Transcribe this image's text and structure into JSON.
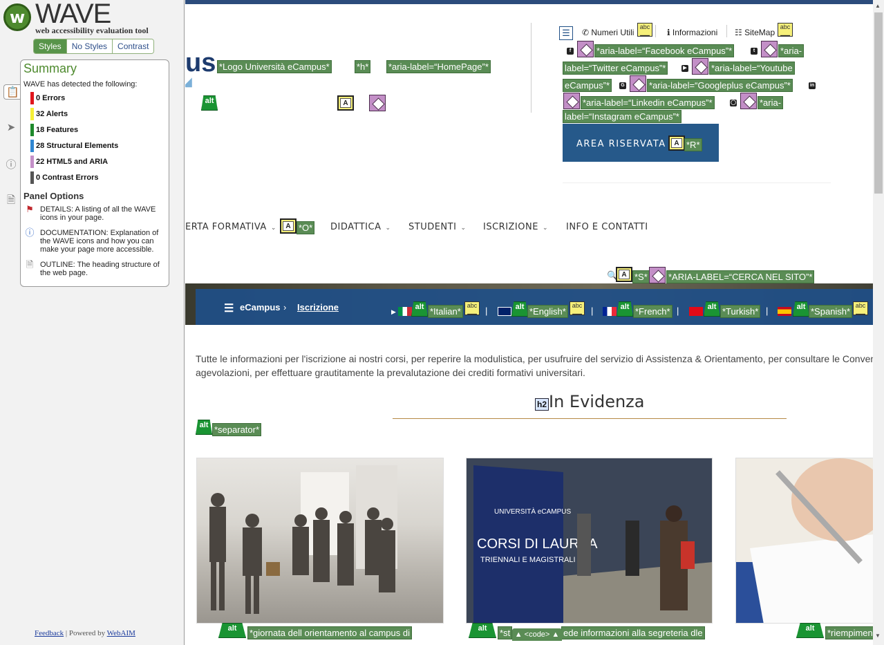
{
  "wave": {
    "title": "WAVE",
    "subtitle": "web accessibility evaluation tool",
    "tabs": [
      {
        "label": "Styles",
        "active": true
      },
      {
        "label": "No Styles",
        "active": false
      },
      {
        "label": "Contrast",
        "active": false
      }
    ],
    "sidebar_icons": [
      "clipboard-icon",
      "flag-icon",
      "info-icon",
      "document-icon"
    ],
    "summary": {
      "title": "Summary",
      "intro": "WAVE has detected the following:",
      "counts": [
        {
          "label": "0 Errors",
          "color": "#e0161c"
        },
        {
          "label": "32 Alerts",
          "color": "#f5ef37"
        },
        {
          "label": "18 Features",
          "color": "#1f8a2c"
        },
        {
          "label": "28 Structural Elements",
          "color": "#2f86d1"
        },
        {
          "label": "22 HTML5 and ARIA",
          "color": "#c490c8"
        },
        {
          "label": "0 Contrast Errors",
          "color": "#555555"
        }
      ]
    },
    "panel_options": {
      "title": "Panel Options",
      "items": [
        {
          "icon": "red-flag-icon",
          "text": "DETAILS: A listing of all the WAVE icons in your page."
        },
        {
          "icon": "info-icon",
          "text": "DOCUMENTATION: Explanation of the WAVE icons and how you can make your page more accessible."
        },
        {
          "icon": "outline-icon",
          "text": "OUTLINE: The heading structure of the web page."
        }
      ]
    },
    "footer": {
      "feedback": "Feedback",
      "sep": " | Powered by ",
      "webaim": "WebAIM"
    }
  },
  "page": {
    "logo_fragment": "us",
    "header_labels": {
      "logo": "*Logo Università eCampus*",
      "h": "*h*",
      "homepage": "*aria-label=“HomePage”*"
    },
    "utility": {
      "numeri": "Numeri Utili",
      "informazioni": "Informazioni",
      "sitemap": "SiteMap"
    },
    "social_labels": [
      "*aria-label=“Facebook eCampus”*",
      "*aria-",
      "label=“Twitter eCampus”*",
      "*aria-label=“Youtube",
      "eCampus”*",
      "*aria-label=“Googleplus eCampus”*",
      "*aria-label=“Linkedin eCampus”*",
      "*aria-",
      "label=“Instagram eCampus”*"
    ],
    "area_riservata": "AREA RISERVATA",
    "area_label": "*R*",
    "nav": [
      "ERTA FORMATIVA",
      "DIDATTICA",
      "STUDENTI",
      "ISCRIZIONE",
      "INFO E CONTATTI"
    ],
    "nav_label": "*O*",
    "search_labels": {
      "s": "*S*",
      "aria": "*ARIA-LABEL=“CERCA NEL SITO”*"
    },
    "breadcrumb": {
      "home": "eCampus",
      "sep": "›",
      "current": "Iscrizione"
    },
    "languages": [
      "*Italian*",
      "*English*",
      "*French*",
      "*Turkish*",
      "*Spanish*"
    ],
    "lang_sep": "|",
    "intro_line1": "Tutte le informazioni per l'iscrizione ai nostri corsi, per reperire la modulistica, per usufruire del servizio di Assistenza & Orientamento, per consultare le Conven",
    "intro_line2": "agevolazioni, per effettuare grautitamente la prevalutazione dei crediti formativi universitari.",
    "h2_badge": "h2",
    "section_title": "In Evidenza",
    "separator_label": "*separator*",
    "card_captions": [
      "*giornata dell orientamento al campus di",
      "*st",
      "ede informazioni alla segreteria dle",
      "*riempimen"
    ],
    "card2_sign": {
      "top": "UNIVERSITÀ eCAMPUS",
      "big": "CORSI DI LAUREA",
      "sub": "TRIENNALI E MAGISTRALI"
    },
    "code_toggle": "▲ <code> ▲"
  }
}
